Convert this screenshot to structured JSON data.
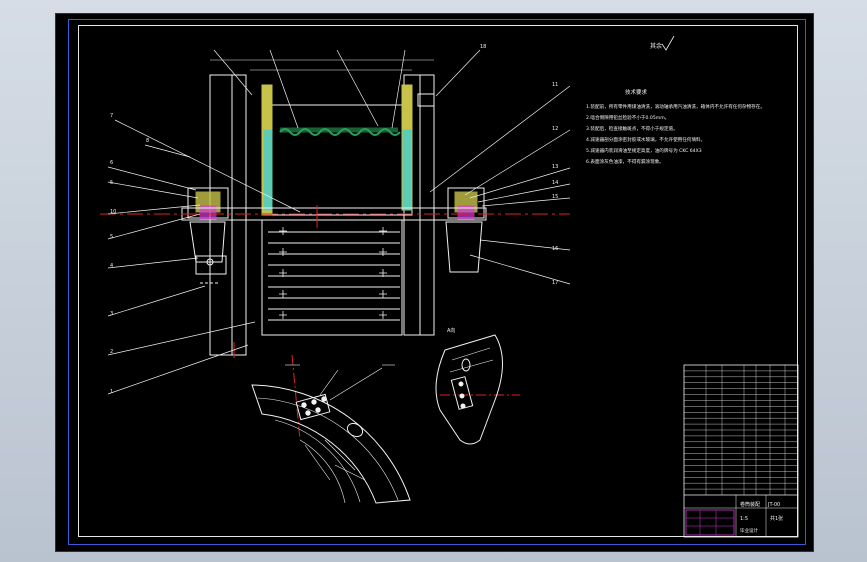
{
  "viewer": {
    "title": "",
    "colors": {
      "background": "#000000",
      "outer_frame": "#3a5bd6",
      "drawing_lines": "#f2f2f2",
      "centerline": "#e02020",
      "section_fill": "#2aa05a",
      "hatch": "#c9c24a",
      "cyan": "#3ad0d8",
      "title_magenta": "#d23ad8"
    }
  },
  "drawing": {
    "roughness_symbol": "其余",
    "notes_title": "技术要求",
    "notes": [
      "1.装配前，所有零件用煤油清洗，滚动轴承用汽油清洗，箱体内不允许有任何杂物存在。",
      "2.啮合侧隙用铅丝检验不小于0.05mm。",
      "3.装配后，检查接触斑点，不得小于规定值。",
      "4.减速器剖分面涂密封胶或水玻璃，不允许使用任何填料。",
      "5.减速器内装润滑油至规定高度，油的牌号为 CKC 64X3",
      "6.表面涂灰色油漆，不得有漏涂现象。"
    ],
    "callouts_left": [
      "7",
      "8",
      "6",
      "5",
      "10",
      "5",
      "4",
      "3",
      "2",
      "1"
    ],
    "callouts_right": [
      "11",
      "12",
      "13",
      "14",
      "15",
      "16",
      "17",
      "18"
    ],
    "view_label": "A向",
    "title_block": {
      "drawing_name": "卷筒装配",
      "scale": "1:5",
      "company": "毕业设计",
      "sheet": "共1张",
      "drawing_no": "JT-00"
    },
    "parts_list_rows": 22
  }
}
